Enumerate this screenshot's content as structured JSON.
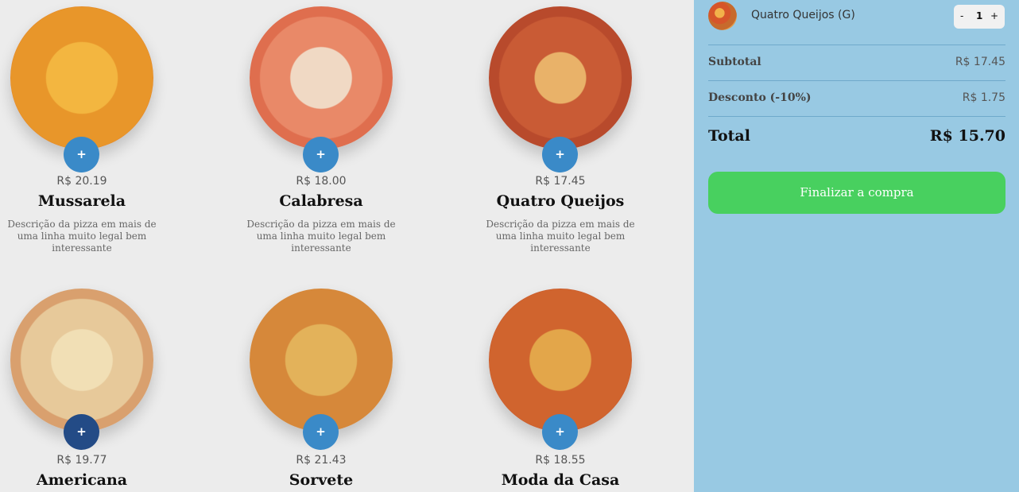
{
  "menu": {
    "pizzas": [
      {
        "name": "Mussarela",
        "price": "R$ 20.19",
        "description": "Descrição da pizza em mais de uma linha muito legal bem interessante",
        "add_label": "+"
      },
      {
        "name": "Calabresa",
        "price": "R$ 18.00",
        "description": "Descrição da pizza em mais de uma linha muito legal bem interessante",
        "add_label": "+"
      },
      {
        "name": "Quatro Queijos",
        "price": "R$ 17.45",
        "description": "Descrição da pizza em mais de uma linha muito legal bem interessante",
        "add_label": "+"
      },
      {
        "name": "Americana",
        "price": "R$ 19.77",
        "add_label": "+"
      },
      {
        "name": "Sorvete",
        "price": "R$ 21.43",
        "add_label": "+"
      },
      {
        "name": "Moda da Casa",
        "price": "R$ 18.55",
        "add_label": "+"
      }
    ]
  },
  "cart": {
    "item": {
      "name": "Quatro Queijos (G)",
      "quantity": "1",
      "minus_label": "-",
      "plus_label": "+"
    },
    "subtotal_label": "Subtotal",
    "subtotal_value": "R$ 17.45",
    "discount_label": "Desconto (-10%)",
    "discount_value": "R$ 1.75",
    "total_label": "Total",
    "total_value": "R$ 15.70",
    "checkout_label": "Finalizar a compra"
  },
  "colors": {
    "cart_background": "#98c9e3",
    "add_button": "#3a8ac8",
    "add_button_active": "#234b86",
    "checkout_button": "#48d05f"
  },
  "icons": {
    "add": "plus-icon"
  }
}
